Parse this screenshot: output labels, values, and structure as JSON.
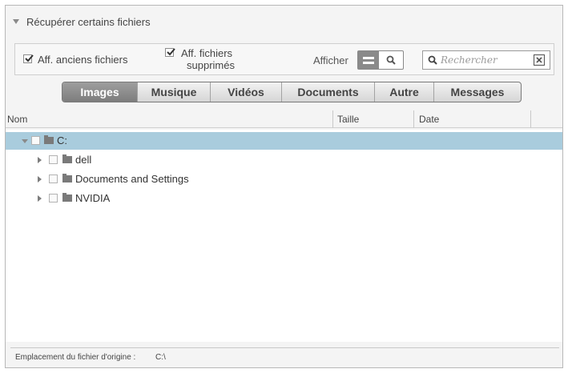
{
  "panel": {
    "title": "Récupérer certains fichiers"
  },
  "options": {
    "show_old_files": {
      "label": "Aff. anciens fichiers",
      "checked": true
    },
    "show_deleted_files": {
      "label_line1": "Aff. fichiers",
      "label_line2": "supprimés",
      "checked": true
    },
    "afficher_label": "Afficher",
    "view_modes": [
      "list-icon",
      "search-icon"
    ]
  },
  "search": {
    "placeholder": "Rechercher",
    "value": ""
  },
  "tabs": [
    {
      "label": "Images",
      "active": true
    },
    {
      "label": "Musique",
      "active": false
    },
    {
      "label": "Vidéos",
      "active": false
    },
    {
      "label": "Documents",
      "active": false
    },
    {
      "label": "Autre",
      "active": false
    },
    {
      "label": "Messages",
      "active": false
    }
  ],
  "columns": {
    "name": "Nom",
    "size": "Taille",
    "date": "Date"
  },
  "tree": [
    {
      "label": "C:",
      "expanded": true,
      "selected": true,
      "level": 0
    },
    {
      "label": "dell",
      "expanded": false,
      "selected": false,
      "level": 1
    },
    {
      "label": "Documents and Settings",
      "expanded": false,
      "selected": false,
      "level": 1
    },
    {
      "label": "NVIDIA",
      "expanded": false,
      "selected": false,
      "level": 1
    }
  ],
  "footer": {
    "label": "Emplacement du fichier d'origine :",
    "path": "C:\\"
  },
  "colors": {
    "selected_row": "#a9ccdd",
    "active_tab": "#8a8a8a",
    "frame_bg": "#f4f4f4"
  }
}
